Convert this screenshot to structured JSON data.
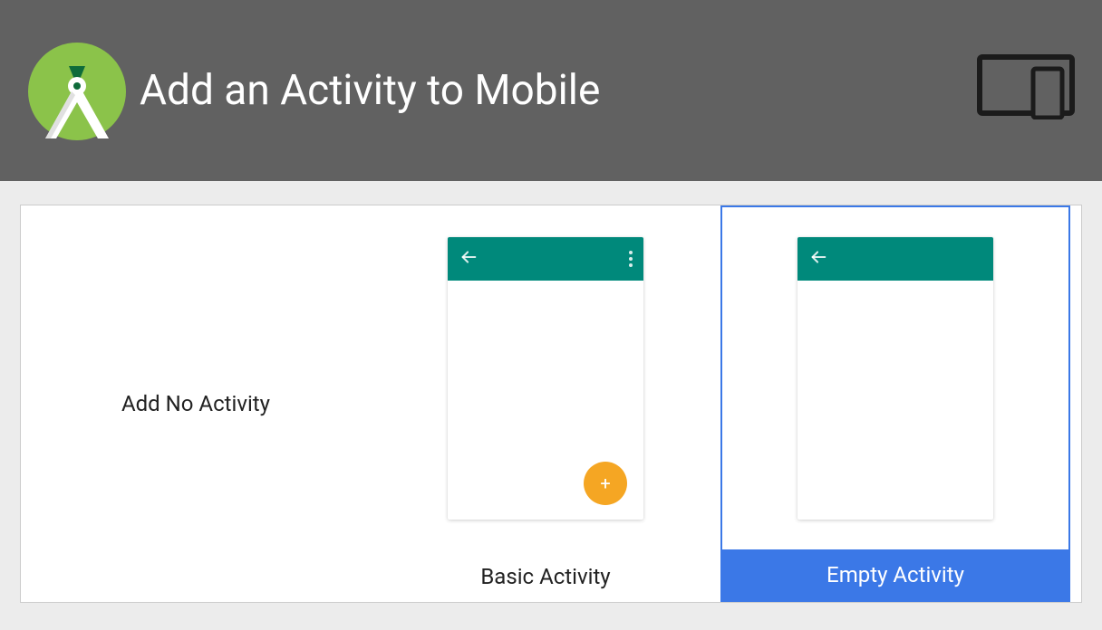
{
  "header": {
    "title": "Add an Activity to Mobile"
  },
  "tiles": {
    "no_activity": "Add No Activity",
    "basic_activity": "Basic Activity",
    "empty_activity": "Empty Activity"
  },
  "colors": {
    "header_bg": "#616161",
    "selection": "#3b78e7",
    "appbar": "#00897b",
    "fab": "#f5a623"
  }
}
